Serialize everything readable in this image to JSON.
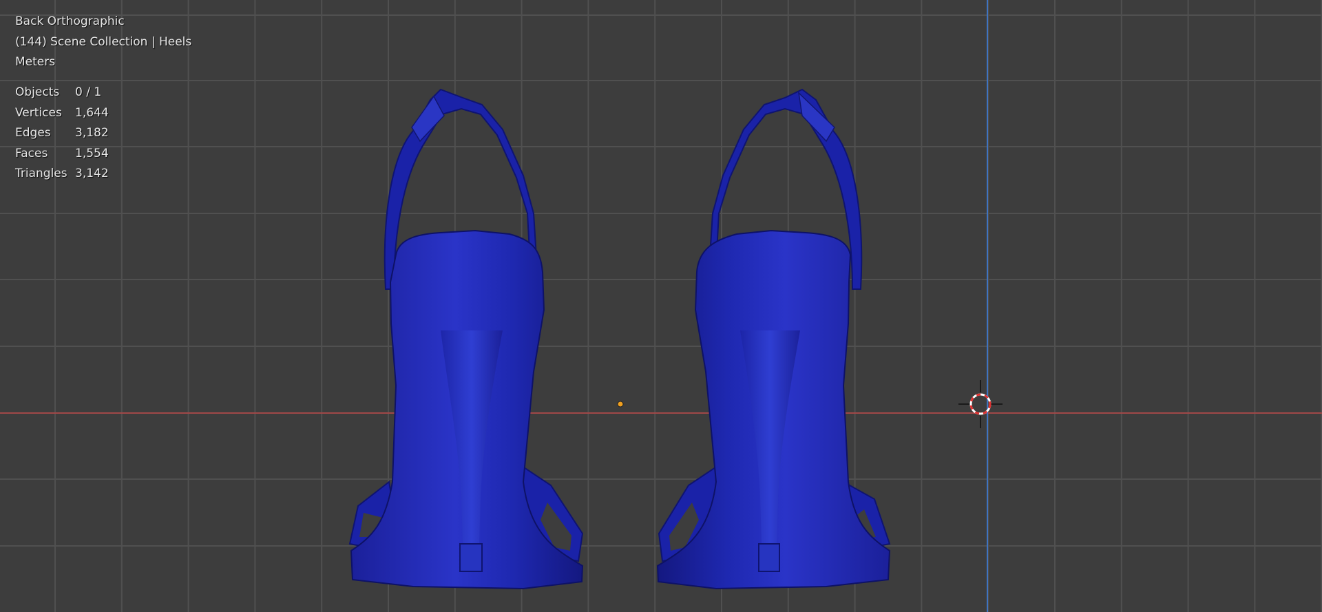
{
  "viewport": {
    "view_name": "Back Orthographic",
    "collection_info": "(144) Scene Collection | Heels",
    "units": "Meters",
    "stats": [
      {
        "label": "Objects",
        "value": "0 / 1"
      },
      {
        "label": "Vertices",
        "value": "1,644"
      },
      {
        "label": "Edges",
        "value": "3,182"
      },
      {
        "label": "Faces",
        "value": "1,554"
      },
      {
        "label": "Triangles",
        "value": "3,142"
      }
    ]
  },
  "colors": {
    "background": "#3d3d3d",
    "grid_line": "#4a4a4a",
    "x_axis": "#a84a4a",
    "z_axis": "#4a7ac4",
    "shoe_blue": "#1a24b0",
    "origin_dot": "#f0a020"
  },
  "icons": {
    "cursor": "3d-cursor-icon",
    "origin": "origin-point-icon"
  }
}
